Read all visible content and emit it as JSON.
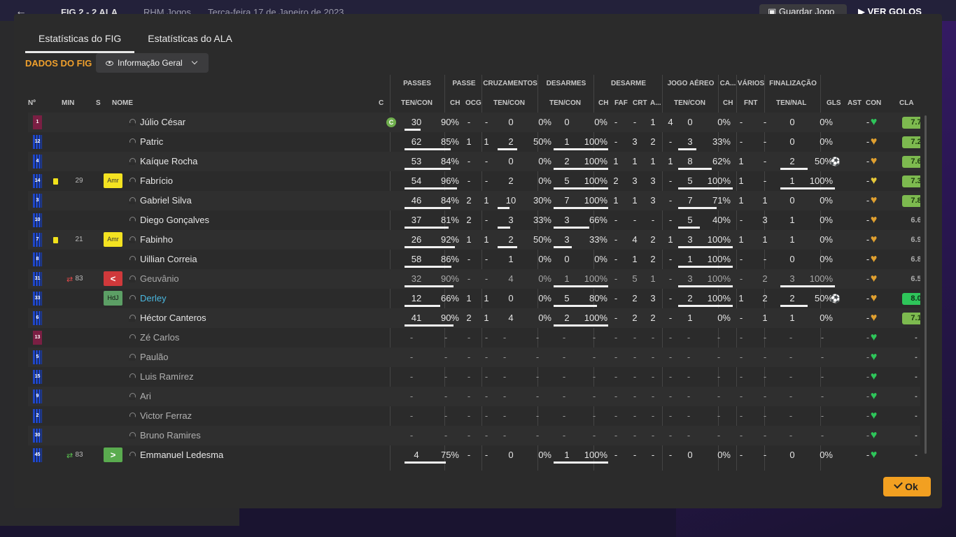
{
  "topbar": {
    "score": "FIG  2 - 2  ALA",
    "studio": "RHM Jogos",
    "date": "Terça-feira 17 de Janeiro de 2023",
    "save": "Guardar Jogo",
    "view": "VER GOLOS"
  },
  "tabs": [
    {
      "label": "Estatísticas do FIG"
    },
    {
      "label": "Estatísticas do ALA"
    }
  ],
  "section": {
    "title": "DADOS DO FIG",
    "view_select": "Informação Geral"
  },
  "groups": {
    "passes": "PASSES",
    "passe": "PASSE",
    "cruzamentos": "CRUZAMENTOS",
    "desarmes": "DESARMES",
    "desarme": "DESARME",
    "jogo_aereo": "JOGO AÉREO",
    "ca": "CA...",
    "varios": "VÁRIOS",
    "finalizacao": "FINALIZAÇÃO"
  },
  "headers": {
    "num": "Nº",
    "min": "MIN",
    "s": "S",
    "nome": "NOME",
    "c": "C",
    "ten_con": "TEN/CON",
    "ch": "CH",
    "ocg": "OCG",
    "faf": "FAF",
    "crt": "CRT",
    "a": "A...",
    "fnt": "FNT",
    "ten_nal": "TEN/NAL",
    "gls": "GLS",
    "ast": "AST",
    "con": "CON",
    "cla": "CLA"
  },
  "colors": {
    "accent": "#f0a02c",
    "rating_green": "#7dba4f",
    "rating_bright": "#2ec55a",
    "link": "#4ab8e0"
  },
  "players": [
    {
      "num": "1",
      "kit": "red",
      "card": false,
      "min": "",
      "badge": "",
      "name": "Júlio César",
      "captain": true,
      "pt": "30",
      "pp": "90%",
      "pc": 30,
      "ch": "-",
      "ocg": "-",
      "ct": "0",
      "cp": "0%",
      "cc": 0,
      "dt": "0",
      "dp": "0%",
      "dc": 0,
      "dch": "-",
      "faf": "-",
      "crt": "1",
      "da": "4",
      "at": "0",
      "ap": "0%",
      "ac": 0,
      "ca": "-",
      "fnt": "-",
      "ft": "0",
      "fp": "0%",
      "fc": 0,
      "gls": "",
      "ast": "-",
      "con": "heart-green",
      "cla": "7.7",
      "clastyle": "green"
    },
    {
      "num": "12",
      "kit": "blue",
      "card": false,
      "min": "",
      "badge": "",
      "name": "Patric",
      "captain": false,
      "pt": "62",
      "pp": "85%",
      "pc": 85,
      "ch": "1",
      "ocg": "1",
      "ct": "2",
      "cp": "50%",
      "cc": 50,
      "dt": "1",
      "dp": "100%",
      "dc": 100,
      "dch": "-",
      "faf": "3",
      "crt": "2",
      "da": "-",
      "at": "3",
      "ap": "33%",
      "ac": 33,
      "ca": "-",
      "fnt": "-",
      "ft": "0",
      "fp": "0%",
      "fc": 0,
      "gls": "",
      "ast": "-",
      "con": "heart-orange",
      "cla": "7.2",
      "clastyle": "green"
    },
    {
      "num": "4",
      "kit": "blue",
      "card": false,
      "min": "",
      "badge": "",
      "name": "Kaíque Rocha",
      "captain": false,
      "pt": "53",
      "pp": "84%",
      "pc": 84,
      "ch": "-",
      "ocg": "-",
      "ct": "0",
      "cp": "0%",
      "cc": 0,
      "dt": "2",
      "dp": "100%",
      "dc": 100,
      "dch": "1",
      "faf": "1",
      "crt": "1",
      "da": "1",
      "at": "8",
      "ap": "62%",
      "ac": 62,
      "ca": "1",
      "fnt": "-",
      "ft": "2",
      "fp": "50%",
      "fc": 50,
      "gls": "ball",
      "ast": "-",
      "con": "heart-orange",
      "cla": "7.6",
      "clastyle": "green"
    },
    {
      "num": "14",
      "kit": "blue",
      "card": true,
      "min": "29",
      "badge": "Amr",
      "name": "Fabrício",
      "captain": false,
      "pt": "54",
      "pp": "96%",
      "pc": 96,
      "ch": "-",
      "ocg": "-",
      "ct": "2",
      "cp": "0%",
      "cc": 0,
      "dt": "5",
      "dp": "100%",
      "dc": 100,
      "dch": "2",
      "faf": "3",
      "crt": "3",
      "da": "-",
      "at": "5",
      "ap": "100%",
      "ac": 100,
      "ca": "1",
      "fnt": "-",
      "ft": "1",
      "fp": "100%",
      "fc": 100,
      "gls": "",
      "ast": "-",
      "con": "heart-yellow",
      "cla": "7.3",
      "clastyle": "green"
    },
    {
      "num": "3",
      "kit": "blue",
      "card": false,
      "min": "",
      "badge": "",
      "name": "Gabriel Silva",
      "captain": false,
      "pt": "46",
      "pp": "84%",
      "pc": 84,
      "ch": "2",
      "ocg": "1",
      "ct": "10",
      "cp": "30%",
      "cc": 30,
      "dt": "7",
      "dp": "100%",
      "dc": 100,
      "dch": "1",
      "faf": "1",
      "crt": "3",
      "da": "-",
      "at": "7",
      "ap": "71%",
      "ac": 71,
      "ca": "1",
      "fnt": "1",
      "ft": "0",
      "fp": "0%",
      "fc": 0,
      "gls": "",
      "ast": "-",
      "con": "heart-orange",
      "cla": "7.8",
      "clastyle": "green"
    },
    {
      "num": "10",
      "kit": "blue",
      "card": false,
      "min": "",
      "badge": "",
      "name": "Diego Gonçalves",
      "captain": false,
      "pt": "37",
      "pp": "81%",
      "pc": 81,
      "ch": "2",
      "ocg": "-",
      "ct": "3",
      "cp": "33%",
      "cc": 33,
      "dt": "3",
      "dp": "66%",
      "dc": 66,
      "dch": "-",
      "faf": "-",
      "crt": "-",
      "da": "-",
      "at": "5",
      "ap": "40%",
      "ac": 40,
      "ca": "-",
      "fnt": "3",
      "ft": "1",
      "fp": "0%",
      "fc": 0,
      "gls": "",
      "ast": "-",
      "con": "heart-orange",
      "cla": "6.6",
      "clastyle": "none"
    },
    {
      "num": "7",
      "kit": "blue",
      "card": true,
      "min": "21",
      "badge": "Amr",
      "name": "Fabinho",
      "captain": false,
      "pt": "26",
      "pp": "92%",
      "pc": 92,
      "ch": "1",
      "ocg": "1",
      "ct": "2",
      "cp": "50%",
      "cc": 50,
      "dt": "3",
      "dp": "33%",
      "dc": 33,
      "dch": "-",
      "faf": "4",
      "crt": "2",
      "da": "1",
      "at": "3",
      "ap": "100%",
      "ac": 100,
      "ca": "1",
      "fnt": "1",
      "ft": "1",
      "fp": "0%",
      "fc": 0,
      "gls": "",
      "ast": "-",
      "con": "heart-orange",
      "cla": "6.9",
      "clastyle": "none"
    },
    {
      "num": "8",
      "kit": "blue",
      "card": false,
      "min": "",
      "badge": "",
      "name": "Uillian Correia",
      "captain": false,
      "pt": "58",
      "pp": "86%",
      "pc": 86,
      "ch": "-",
      "ocg": "-",
      "ct": "1",
      "cp": "0%",
      "cc": 0,
      "dt": "0",
      "dp": "0%",
      "dc": 0,
      "dch": "-",
      "faf": "1",
      "crt": "2",
      "da": "-",
      "at": "1",
      "ap": "100%",
      "ac": 100,
      "ca": "-",
      "fnt": "-",
      "ft": "0",
      "fp": "0%",
      "fc": 0,
      "gls": "",
      "ast": "-",
      "con": "heart-orange",
      "cla": "6.8",
      "clastyle": "none"
    },
    {
      "num": "31",
      "kit": "blue",
      "card": false,
      "subout": true,
      "min": "83",
      "badge": "out",
      "name": "Geuvânio",
      "captain": false,
      "pt": "32",
      "pp": "90%",
      "pc": 90,
      "ch": "-",
      "ocg": "-",
      "ct": "4",
      "cp": "0%",
      "cc": 0,
      "dt": "1",
      "dp": "100%",
      "dc": 100,
      "dch": "-",
      "faf": "5",
      "crt": "1",
      "da": "-",
      "at": "3",
      "ap": "100%",
      "ac": 100,
      "ca": "-",
      "fnt": "2",
      "ft": "3",
      "fp": "100%",
      "fc": 100,
      "gls": "",
      "ast": "-",
      "con": "heart-orange",
      "cla": "6.5",
      "clastyle": "none",
      "dim": true
    },
    {
      "num": "33",
      "kit": "blue",
      "card": false,
      "min": "",
      "badge": "HdJ",
      "name": "Derley",
      "captain": false,
      "pt": "12",
      "pp": "66%",
      "pc": 66,
      "ch": "1",
      "ocg": "1",
      "ct": "0",
      "cp": "0%",
      "cc": 0,
      "dt": "5",
      "dp": "80%",
      "dc": 80,
      "dch": "-",
      "faf": "2",
      "crt": "3",
      "da": "-",
      "at": "2",
      "ap": "100%",
      "ac": 100,
      "ca": "1",
      "fnt": "2",
      "ft": "2",
      "fp": "50%",
      "fc": 50,
      "gls": "ball",
      "ast": "-",
      "con": "heart-orange",
      "cla": "8.0",
      "clastyle": "bright",
      "link": true
    },
    {
      "num": "6",
      "kit": "blue",
      "card": false,
      "min": "",
      "badge": "",
      "name": "Héctor Canteros",
      "captain": false,
      "pt": "41",
      "pp": "90%",
      "pc": 90,
      "ch": "2",
      "ocg": "1",
      "ct": "4",
      "cp": "0%",
      "cc": 0,
      "dt": "2",
      "dp": "100%",
      "dc": 100,
      "dch": "-",
      "faf": "2",
      "crt": "2",
      "da": "-",
      "at": "1",
      "ap": "0%",
      "ac": 0,
      "ca": "-",
      "fnt": "1",
      "ft": "1",
      "fp": "0%",
      "fc": 0,
      "gls": "",
      "ast": "-",
      "con": "heart-orange",
      "cla": "7.1",
      "clastyle": "green"
    },
    {
      "num": "13",
      "kit": "red",
      "empty": true,
      "name": "Zé Carlos"
    },
    {
      "num": "5",
      "kit": "blue",
      "empty": true,
      "name": "Paulão"
    },
    {
      "num": "15",
      "kit": "blue",
      "empty": true,
      "name": "Luis Ramírez"
    },
    {
      "num": "9",
      "kit": "blue",
      "empty": true,
      "name": "Ari"
    },
    {
      "num": "2",
      "kit": "blue",
      "empty": true,
      "name": "Victor Ferraz"
    },
    {
      "num": "30",
      "kit": "blue",
      "empty": true,
      "name": "Bruno Ramires"
    },
    {
      "num": "45",
      "kit": "blue",
      "card": false,
      "subin": true,
      "min": "83",
      "badge": "in",
      "name": "Emmanuel Ledesma",
      "captain": false,
      "pt": "4",
      "pp": "75%",
      "pc": 75,
      "ch": "-",
      "ocg": "-",
      "ct": "0",
      "cp": "0%",
      "cc": 0,
      "dt": "1",
      "dp": "100%",
      "dc": 100,
      "dch": "-",
      "faf": "-",
      "crt": "-",
      "da": "-",
      "at": "0",
      "ap": "0%",
      "ac": 0,
      "ca": "-",
      "fnt": "-",
      "ft": "0",
      "fp": "0%",
      "fc": 0,
      "gls": "",
      "ast": "-",
      "con": "heart-green",
      "cla": "-",
      "clastyle": "none"
    }
  ],
  "ok_button": "Ok"
}
